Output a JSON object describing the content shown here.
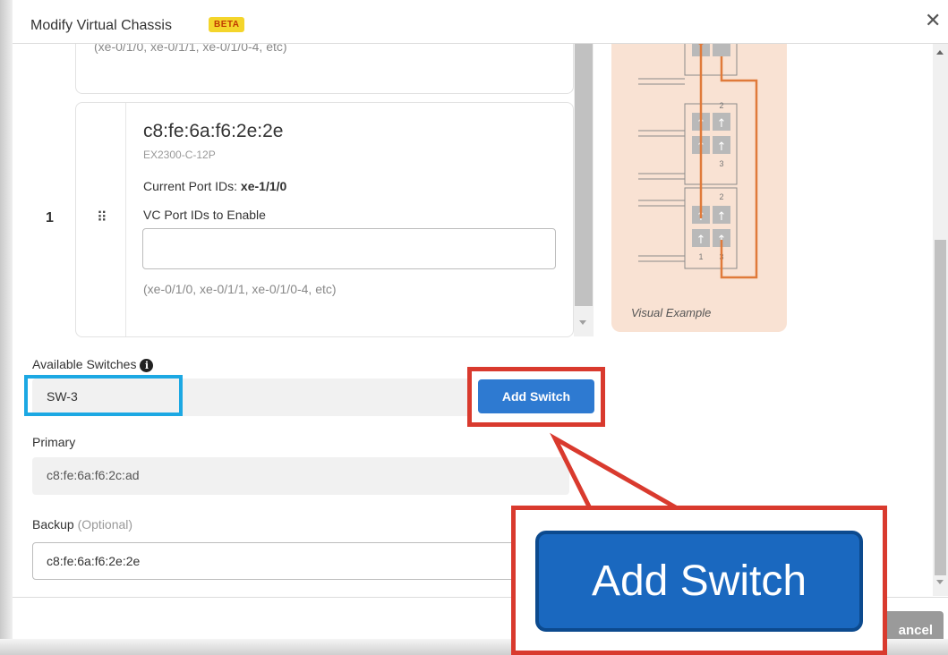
{
  "modal": {
    "title": "Modify Virtual Chassis",
    "beta_badge": "BETA",
    "close_glyph": "✕"
  },
  "members": [
    {
      "port_hint": "(xe-0/1/0, xe-0/1/1, xe-0/1/0-4, etc)"
    },
    {
      "row_number": "1",
      "drag_handle_glyph": "⠿",
      "mac": "c8:fe:6a:f6:2e:2e",
      "model": "EX2300-C-12P",
      "current_port_ids_label": "Current Port IDs:",
      "current_port_ids_value": "xe-1/1/0",
      "vc_port_ids_label": "VC Port IDs to Enable",
      "vc_port_ids_value": "",
      "port_hint": "(xe-0/1/0, xe-0/1/1, xe-0/1/0-4, etc)"
    }
  ],
  "visual_example": {
    "caption": "Visual Example",
    "labels": [
      "2",
      "3",
      "2",
      "1",
      "3"
    ]
  },
  "available_switches": {
    "label": "Available Switches",
    "info_glyph": "i",
    "selected": "SW-3",
    "add_button_label": "Add Switch"
  },
  "primary": {
    "label": "Primary",
    "value": "c8:fe:6a:f6:2c:ad"
  },
  "backup": {
    "label": "Backup",
    "optional": "(Optional)",
    "value": "c8:fe:6a:f6:2e:2e"
  },
  "footer": {
    "cancel_label": "ancel"
  },
  "callout": {
    "zoom_button_label": "Add Switch"
  },
  "colors": {
    "highlight_red": "#d93a2e",
    "highlight_blue": "#1ca8e3",
    "button_blue": "#2e7ad1",
    "beta_yellow": "#f4d52b",
    "visual_bg": "#f9e2d3",
    "link_orange": "#e07a3a"
  }
}
